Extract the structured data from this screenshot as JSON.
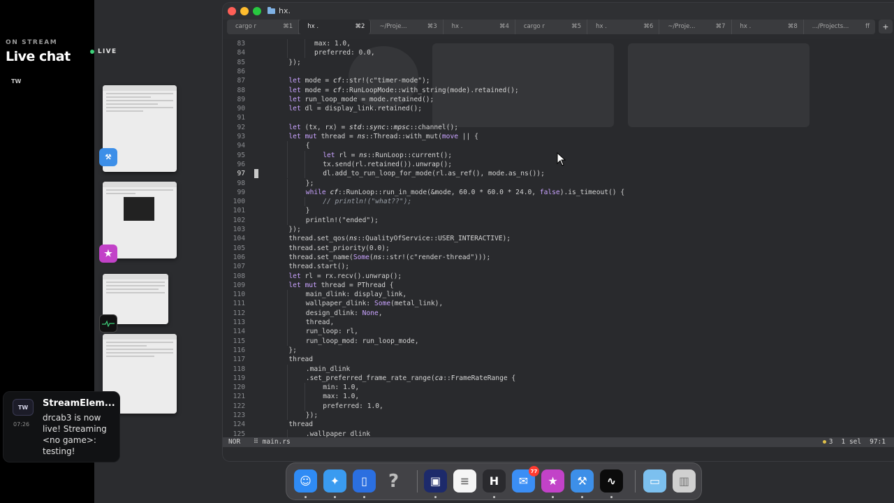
{
  "stream": {
    "on_stream": "ON STREAM",
    "live_chat": "Live chat",
    "tw": "TW",
    "live": "LIVE"
  },
  "notification": {
    "avatar": "TW",
    "time": "07:26",
    "title": "StreamElem...",
    "body": "drcab3 is now live! Streaming <no game>: testing!"
  },
  "window": {
    "title": "hx.",
    "tabs": [
      {
        "label": "cargo r",
        "key": "⌘1"
      },
      {
        "label": "hx .",
        "key": "⌘2",
        "active": true
      },
      {
        "label": "~/Proje...",
        "key": "⌘3"
      },
      {
        "label": "hx .",
        "key": "⌘4"
      },
      {
        "label": "cargo r",
        "key": "⌘5"
      },
      {
        "label": "hx .",
        "key": "⌘6"
      },
      {
        "label": "~/Proje...",
        "key": "⌘7"
      },
      {
        "label": "hx .",
        "key": "⌘8"
      },
      {
        "label": ".../Projects...",
        "key": "ff"
      }
    ],
    "add_tab": "+"
  },
  "editor": {
    "current_line": 97,
    "lines": [
      {
        "n": "83",
        "code": "max: 1.0,",
        "indent": 5
      },
      {
        "n": "84",
        "code": "preferred: 0.0,",
        "indent": 5
      },
      {
        "n": "85",
        "code": "});",
        "indent": 2
      },
      {
        "n": "86",
        "code": "",
        "indent": 0
      },
      {
        "n": "87",
        "code": "let mode = cf::str!(c\"timer-mode\");",
        "indent": 2
      },
      {
        "n": "88",
        "code": "let mode = cf::RunLoopMode::with_string(mode).retained();",
        "indent": 2
      },
      {
        "n": "89",
        "code": "let run_loop_mode = mode.retained();",
        "indent": 2
      },
      {
        "n": "90",
        "code": "let dl = display_link.retained();",
        "indent": 2
      },
      {
        "n": "91",
        "code": "",
        "indent": 0
      },
      {
        "n": "92",
        "code": "let (tx, rx) = std::sync::mpsc::channel();",
        "indent": 2
      },
      {
        "n": "93",
        "code": "let mut thread = ns::Thread::with_mut(move || {",
        "indent": 2
      },
      {
        "n": "94",
        "code": "{",
        "indent": 4
      },
      {
        "n": "95",
        "code": "let rl = ns::RunLoop::current();",
        "indent": 6
      },
      {
        "n": "96",
        "code": "tx.send(rl.retained()).unwrap();",
        "indent": 6
      },
      {
        "n": "97",
        "code": "dl.add_to_run_loop_for_mode(rl.as_ref(), mode.as_ns());",
        "indent": 6
      },
      {
        "n": "98",
        "code": "};",
        "indent": 4
      },
      {
        "n": "99",
        "code": "while cf::RunLoop::run_in_mode(&mode, 60.0 * 60.0 * 24.0, false).is_timeout() {",
        "indent": 4
      },
      {
        "n": "100",
        "code": "// println!(\"what??\");",
        "indent": 6
      },
      {
        "n": "101",
        "code": "}",
        "indent": 4
      },
      {
        "n": "102",
        "code": "println!(\"ended\");",
        "indent": 4
      },
      {
        "n": "103",
        "code": "});",
        "indent": 2
      },
      {
        "n": "104",
        "code": "thread.set_qos(ns::QualityOfService::USER_INTERACTIVE);",
        "indent": 2
      },
      {
        "n": "105",
        "code": "thread.set_priority(0.0);",
        "indent": 2
      },
      {
        "n": "106",
        "code": "thread.set_name(Some(ns::str!(c\"render-thread\")));",
        "indent": 2
      },
      {
        "n": "107",
        "code": "thread.start();",
        "indent": 2
      },
      {
        "n": "108",
        "code": "let rl = rx.recv().unwrap();",
        "indent": 2
      },
      {
        "n": "109",
        "code": "let mut thread = PThread {",
        "indent": 2
      },
      {
        "n": "110",
        "code": "main_dlink: display_link,",
        "indent": 4
      },
      {
        "n": "111",
        "code": "wallpaper_dlink: Some(metal_link),",
        "indent": 4
      },
      {
        "n": "112",
        "code": "design_dlink: None,",
        "indent": 4
      },
      {
        "n": "113",
        "code": "thread,",
        "indent": 4
      },
      {
        "n": "114",
        "code": "run_loop: rl,",
        "indent": 4
      },
      {
        "n": "115",
        "code": "run_loop_mod: run_loop_mode,",
        "indent": 4
      },
      {
        "n": "116",
        "code": "};",
        "indent": 2
      },
      {
        "n": "117",
        "code": "thread",
        "indent": 2
      },
      {
        "n": "118",
        "code": ".main_dlink",
        "indent": 4
      },
      {
        "n": "119",
        "code": ".set_preferred_frame_rate_range(ca::FrameRateRange {",
        "indent": 4
      },
      {
        "n": "120",
        "code": "min: 1.0,",
        "indent": 6
      },
      {
        "n": "121",
        "code": "max: 1.0,",
        "indent": 6
      },
      {
        "n": "122",
        "code": "preferred: 1.0,",
        "indent": 6
      },
      {
        "n": "123",
        "code": "});",
        "indent": 4
      },
      {
        "n": "124",
        "code": "thread",
        "indent": 2
      },
      {
        "n": "125",
        "code": ".wallpaper_dlink",
        "indent": 4
      }
    ]
  },
  "statusline": {
    "mode": "NOR",
    "file": "⠿ main.rs",
    "diagnostics": "3",
    "selection": "1 sel",
    "position": "97:1"
  },
  "dock": {
    "mail_badge": "77",
    "apps": [
      {
        "name": "finder-icon",
        "color": "#2f8bf5"
      },
      {
        "name": "safari-icon",
        "color": "#3a9bf0"
      },
      {
        "name": "simulator-icon",
        "color": "#2b6fe0"
      },
      {
        "name": "help-icon",
        "color": "transparent"
      },
      {
        "name": "screen-sharing-icon",
        "color": "#1d2a6b"
      },
      {
        "name": "notes-icon",
        "color": "#f5f5f5"
      },
      {
        "name": "helix-icon",
        "color": "#2a2a2e"
      },
      {
        "name": "mail-icon",
        "color": "#3b8ef5"
      },
      {
        "name": "feedback-icon",
        "color": "#c242c8"
      },
      {
        "name": "xcode-beta-icon",
        "color": "#3d8fe8"
      },
      {
        "name": "activity-monitor-icon",
        "color": "#0b0b0b"
      },
      {
        "name": "downloads-folder-icon",
        "color": "#7cc0ef"
      },
      {
        "name": "trash-icon",
        "color": "#d0d0d0"
      }
    ]
  }
}
